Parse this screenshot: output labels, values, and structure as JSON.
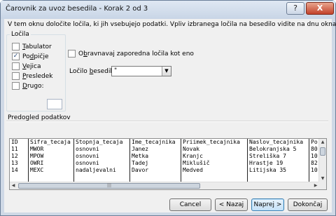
{
  "window": {
    "title": "Čarovnik za uvoz besedila - Korak 2 od 3",
    "help_label": "?",
    "close_label": "X"
  },
  "intro_text": "V tem oknu določite ločila, ki jih vsebujejo podatki. Vpliv izbranega ločila na besedilo vidite na dnu okna.",
  "delimiters": {
    "legend": "Ločila",
    "items": [
      {
        "label": "Tabulator",
        "accel": "T",
        "rest": "abulator",
        "pre": "",
        "checked": false
      },
      {
        "label": "Podpičje",
        "accel": "d",
        "rest": "pičje",
        "pre": "Po",
        "checked": true
      },
      {
        "label": "Vejica",
        "accel": "V",
        "rest": "ejica",
        "pre": "",
        "checked": false
      },
      {
        "label": "Presledek",
        "accel": "P",
        "rest": "resledek",
        "pre": "",
        "checked": false
      },
      {
        "label": "Drugo:",
        "accel": "D",
        "rest": "rugo:",
        "pre": "",
        "checked": false
      }
    ],
    "other_value": ""
  },
  "consecutive": {
    "checked": false,
    "pre": "O",
    "accel": "b",
    "rest": "ravnavaj zaporedna ločila kot eno"
  },
  "text_qualifier": {
    "pre": "Ločilo ",
    "accel": "b",
    "rest": "esedila:",
    "value": "\""
  },
  "preview": {
    "label": "Predogled podatkov",
    "columns": [
      "ID",
      "Sifra_tecaja",
      "Stopnja_tecaja",
      "Ime_tecajnika",
      "Priimek_tecajnika",
      "Naslov_tecajnika",
      "Po"
    ],
    "rows": [
      [
        "11",
        "MWOR",
        "osnovni",
        "Janez",
        "Novak",
        "Belokranjska 5",
        "80"
      ],
      [
        "12",
        "MPOW",
        "osnovni",
        "Metka",
        "Kranjc",
        "Streliška 7",
        "10"
      ],
      [
        "13",
        "OWRI",
        "osnovni",
        "Tadej",
        "Miklušič",
        "Hrastje 19",
        "82"
      ],
      [
        "14",
        "MEXC",
        "nadaljevalni",
        "Davor",
        "Medved",
        "Litijska 35",
        "10"
      ]
    ]
  },
  "buttons": {
    "cancel": "Cancel",
    "back": "< Nazaj",
    "next": "Naprej >",
    "finish": "Dokončaj"
  }
}
